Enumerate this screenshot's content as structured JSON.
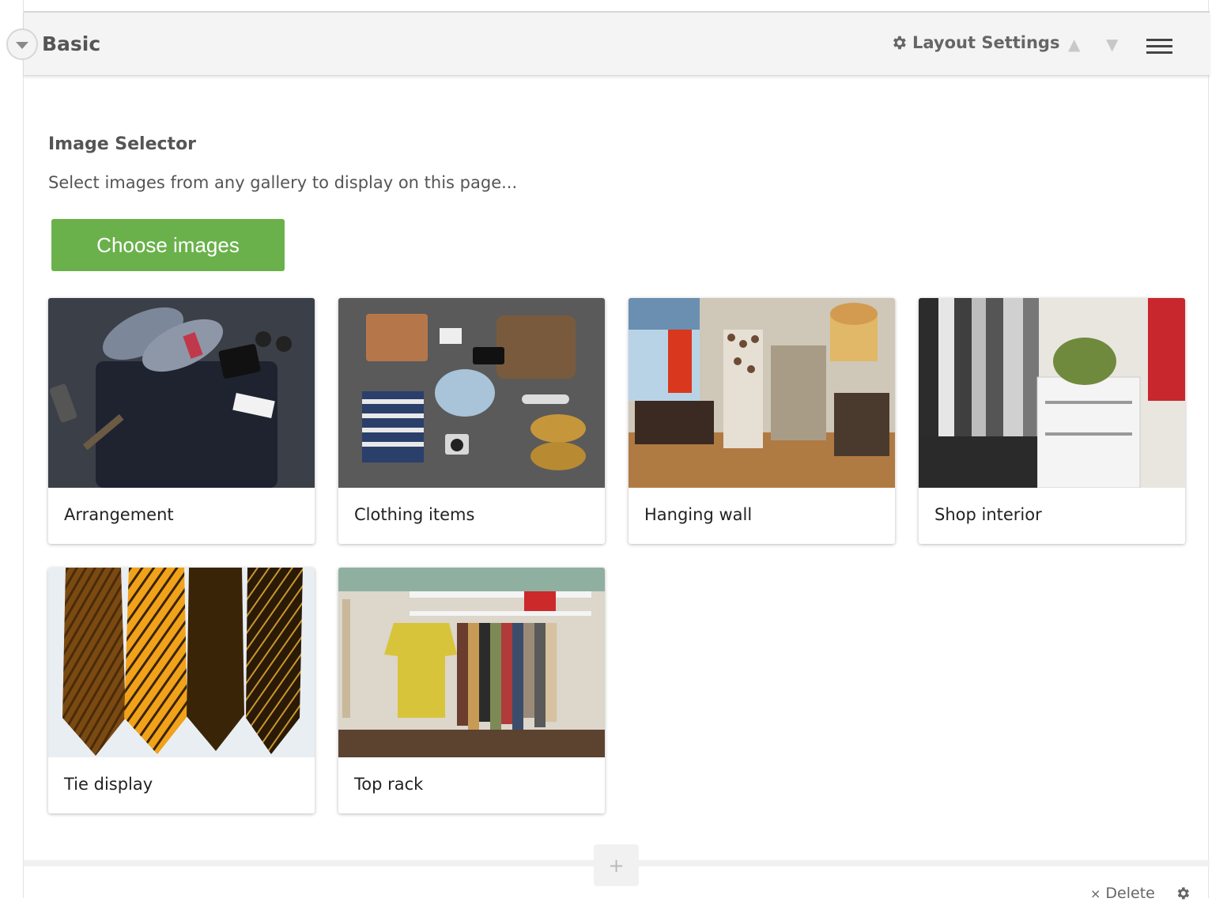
{
  "header": {
    "title": "Basic",
    "layout_settings_label": "Layout Settings",
    "move_up_glyph": "▲",
    "move_down_glyph": "▼"
  },
  "section": {
    "title": "Image Selector",
    "description": "Select images from any gallery to display on this page...",
    "choose_button_label": "Choose images",
    "choose_button_color": "#6ab14b"
  },
  "images": [
    {
      "caption": "Arrangement"
    },
    {
      "caption": "Clothing items"
    },
    {
      "caption": "Hanging wall"
    },
    {
      "caption": "Shop interior"
    },
    {
      "caption": "Tie display"
    },
    {
      "caption": "Top rack"
    }
  ],
  "footer": {
    "add_label": "+",
    "delete_label": "Delete",
    "delete_glyph": "×"
  }
}
